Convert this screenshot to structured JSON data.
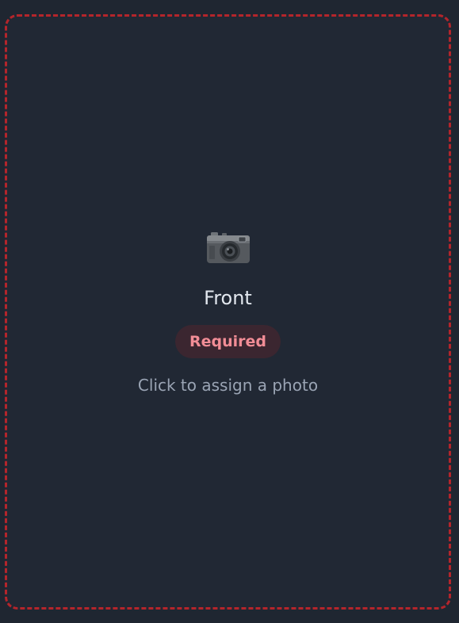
{
  "slot": {
    "title": "Front",
    "badge": "Required",
    "hint": "Click to assign a photo",
    "icon": "camera-icon",
    "border_color": "#b4252b",
    "badge_text_color": "#f28d96"
  }
}
